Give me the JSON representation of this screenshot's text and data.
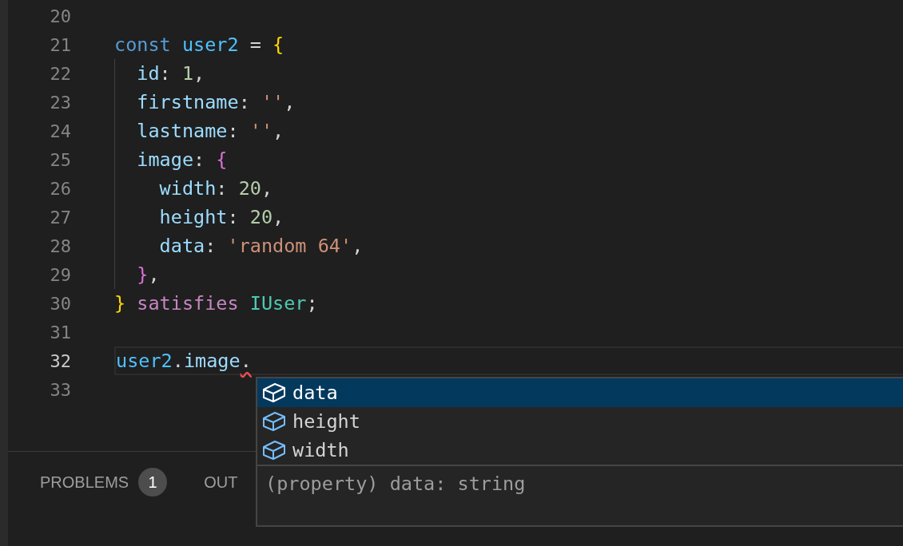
{
  "editor": {
    "lines": [
      {
        "number": "20",
        "current": false
      },
      {
        "number": "21",
        "current": false,
        "tokens": [
          {
            "text": "const ",
            "kind": "keyword"
          },
          {
            "text": "user2",
            "kind": "variable"
          },
          {
            "text": " = ",
            "kind": "punct"
          },
          {
            "text": "{",
            "kind": "brace1"
          }
        ]
      },
      {
        "number": "22",
        "current": false,
        "tokens": [
          {
            "text": "  id",
            "kind": "property"
          },
          {
            "text": ": ",
            "kind": "punct"
          },
          {
            "text": "1",
            "kind": "number"
          },
          {
            "text": ",",
            "kind": "punct"
          }
        ]
      },
      {
        "number": "23",
        "current": false,
        "tokens": [
          {
            "text": "  firstname",
            "kind": "property"
          },
          {
            "text": ": ",
            "kind": "punct"
          },
          {
            "text": "''",
            "kind": "string"
          },
          {
            "text": ",",
            "kind": "punct"
          }
        ]
      },
      {
        "number": "24",
        "current": false,
        "tokens": [
          {
            "text": "  lastname",
            "kind": "property"
          },
          {
            "text": ": ",
            "kind": "punct"
          },
          {
            "text": "''",
            "kind": "string"
          },
          {
            "text": ",",
            "kind": "punct"
          }
        ]
      },
      {
        "number": "25",
        "current": false,
        "tokens": [
          {
            "text": "  image",
            "kind": "property"
          },
          {
            "text": ": ",
            "kind": "punct"
          },
          {
            "text": "{",
            "kind": "brace2"
          }
        ]
      },
      {
        "number": "26",
        "current": false,
        "tokens": [
          {
            "text": "    width",
            "kind": "property"
          },
          {
            "text": ": ",
            "kind": "punct"
          },
          {
            "text": "20",
            "kind": "number"
          },
          {
            "text": ",",
            "kind": "punct"
          }
        ]
      },
      {
        "number": "27",
        "current": false,
        "tokens": [
          {
            "text": "    height",
            "kind": "property"
          },
          {
            "text": ": ",
            "kind": "punct"
          },
          {
            "text": "20",
            "kind": "number"
          },
          {
            "text": ",",
            "kind": "punct"
          }
        ]
      },
      {
        "number": "28",
        "current": false,
        "tokens": [
          {
            "text": "    data",
            "kind": "property"
          },
          {
            "text": ": ",
            "kind": "punct"
          },
          {
            "text": "'random 64'",
            "kind": "string"
          },
          {
            "text": ",",
            "kind": "punct"
          }
        ]
      },
      {
        "number": "29",
        "current": false,
        "tokens": [
          {
            "text": "  }",
            "kind": "brace2"
          },
          {
            "text": ",",
            "kind": "punct"
          }
        ]
      },
      {
        "number": "30",
        "current": false,
        "tokens": [
          {
            "text": "} ",
            "kind": "brace1"
          },
          {
            "text": "satisfies ",
            "kind": "control"
          },
          {
            "text": "IUser",
            "kind": "type"
          },
          {
            "text": ";",
            "kind": "punct"
          }
        ]
      },
      {
        "number": "31",
        "current": false
      },
      {
        "number": "32",
        "current": true,
        "tokens": [
          {
            "text": "user2",
            "kind": "variable"
          },
          {
            "text": ".",
            "kind": "punct"
          },
          {
            "text": "image",
            "kind": "property"
          },
          {
            "text": ".",
            "kind": "punct",
            "error": true
          }
        ]
      },
      {
        "number": "33",
        "current": false
      }
    ]
  },
  "panel": {
    "tabs": [
      {
        "label": "PROBLEMS",
        "badge": "1"
      },
      {
        "label": "OUT"
      }
    ]
  },
  "suggest": {
    "items": [
      {
        "label": "data",
        "selected": true
      },
      {
        "label": "height",
        "selected": false
      },
      {
        "label": "width",
        "selected": false
      }
    ],
    "detail": "(property) data: string"
  }
}
